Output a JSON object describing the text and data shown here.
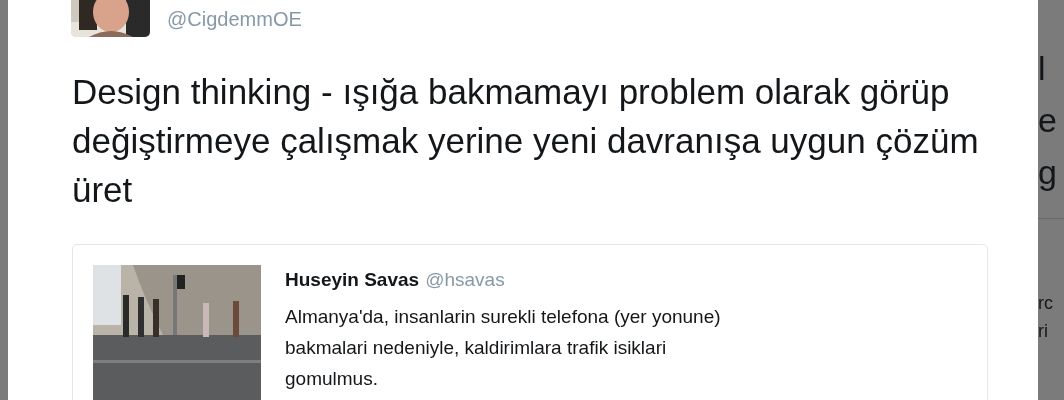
{
  "tweet": {
    "author": {
      "handle": "@CigdemmOE"
    },
    "text": "Design thinking - ışığa bakmamayı problem olarak görüp değiştirmeye çalışmak yerine yeni davranışa uygun çözüm üret",
    "quoted": {
      "name": "Huseyin Savas",
      "handle": "@hsavas",
      "text": "Almanya'da, insanlarin surekli telefona (yer yonune) bakmalari nedeniyle, kaldirimlara trafik isiklari gomulmus."
    }
  },
  "background_fragments": {
    "upper": [
      "l",
      "e",
      "g"
    ],
    "lower": [
      "rc",
      "ri"
    ]
  }
}
